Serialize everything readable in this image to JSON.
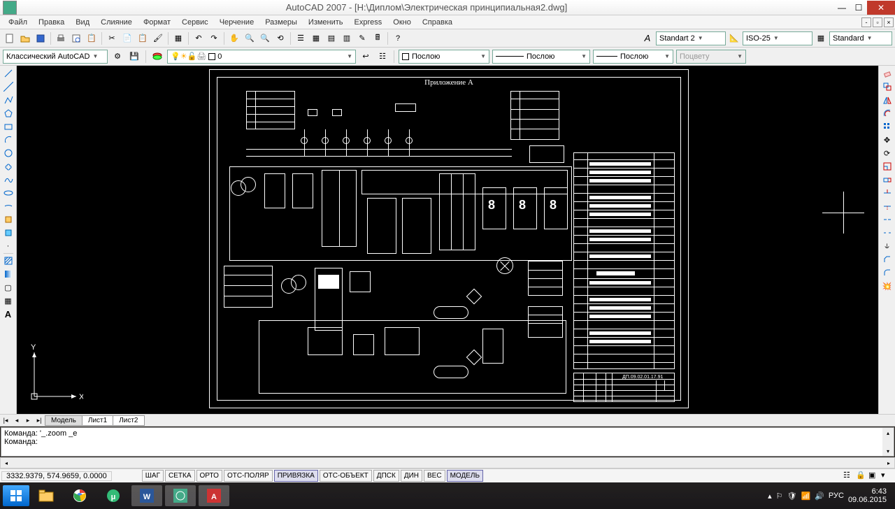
{
  "title": "AutoCAD 2007 - [H:\\Диплом\\Электрическая принципиальная2.dwg]",
  "menu": {
    "items": [
      "Файл",
      "Правка",
      "Вид",
      "Слияние",
      "Формат",
      "Сервис",
      "Черчение",
      "Размеры",
      "Изменить",
      "Express",
      "Окно",
      "Справка"
    ]
  },
  "toolbar1": {
    "text_style": "Standart 2",
    "dim_style": "ISO-25",
    "table_style": "Standard"
  },
  "toolbar2": {
    "workspace": "Классический AutoCAD",
    "layer": "0",
    "linetype": "Послою",
    "lineweight": "Послою",
    "linecolor": "Послою",
    "plotstyle": "Поцвету"
  },
  "ucs": {
    "x_label": "X",
    "y_label": "Y"
  },
  "drawing": {
    "title": "Приложение А",
    "titleblock_id": "ДП.09.02.01.17.91",
    "seg1": "8",
    "seg2": "8",
    "seg3": "8"
  },
  "tabs": {
    "active": "Модель",
    "sheets": [
      "Лист1",
      "Лист2"
    ]
  },
  "command": {
    "line1": "Команда: '_.zoom _e",
    "prompt": "Команда:"
  },
  "status": {
    "coords": "3332.9379, 574.9659, 0.0000",
    "buttons": [
      "ШАГ",
      "СЕТКА",
      "ОРТО",
      "ОТС-ПОЛЯР",
      "ПРИВЯЗКА",
      "ОТС-ОБЪЕКТ",
      "ДПСК",
      "ДИН",
      "ВЕС",
      "МОДЕЛЬ"
    ],
    "active_buttons": [
      "ПРИВЯЗКА",
      "МОДЕЛЬ"
    ]
  },
  "systray": {
    "lang": "РУС",
    "time": "6:43",
    "date": "09.06.2015"
  }
}
